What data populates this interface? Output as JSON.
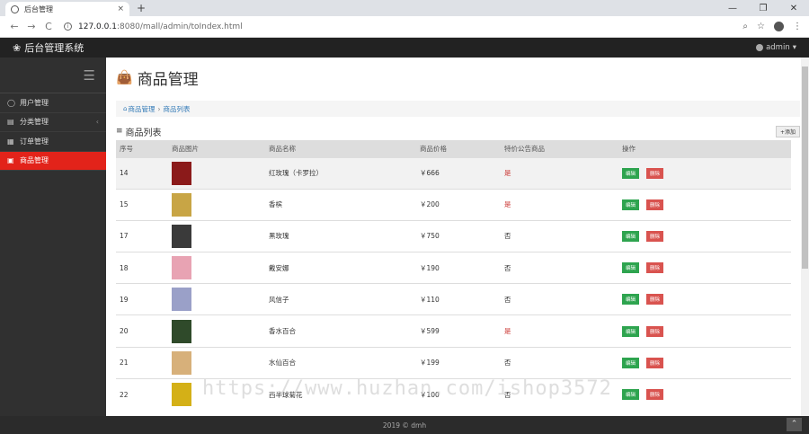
{
  "browser": {
    "tab_title": "后台管理",
    "tab_close": "×",
    "new_tab": "+",
    "win_min": "—",
    "win_max": "❐",
    "win_close": "✕",
    "url_host": "127.0.0.1",
    "url_path": ":8080/mall/admin/toIndex.html",
    "back": "←",
    "forward": "→",
    "reload": "C",
    "zoom_icon": "⌕",
    "star_icon": "☆",
    "menu_icon": "⋮"
  },
  "header": {
    "brand": "后台管理系统",
    "user": "admin"
  },
  "sidebar": {
    "items": [
      {
        "label": "用户管理",
        "icon": "user-icon",
        "glyph": "◯"
      },
      {
        "label": "分类管理",
        "icon": "category-icon",
        "glyph": "▤"
      },
      {
        "label": "订单管理",
        "icon": "order-icon",
        "glyph": "▦"
      },
      {
        "label": "商品管理",
        "icon": "bag-icon",
        "glyph": "▣"
      }
    ],
    "chevron": "‹",
    "active_index": 3
  },
  "main": {
    "title": "商品管理",
    "breadcrumb": [
      "商品管理",
      "商品列表"
    ],
    "section_title": "商品列表",
    "add_button": "+添加",
    "columns": [
      "序号",
      "商品图片",
      "商品名称",
      "商品价格",
      "特价公告商品",
      "操作"
    ],
    "rows": [
      {
        "id": "14",
        "name": "红玫瑰（卡罗拉）",
        "price": "￥666",
        "special": "是",
        "thumb": "#8b1a1a"
      },
      {
        "id": "15",
        "name": "香槟",
        "price": "￥200",
        "special": "是",
        "thumb": "#c8a545"
      },
      {
        "id": "17",
        "name": "黑玫瑰",
        "price": "￥750",
        "special": "否",
        "thumb": "#3a3a3a"
      },
      {
        "id": "18",
        "name": "戴安娜",
        "price": "￥190",
        "special": "否",
        "thumb": "#e8a3b3"
      },
      {
        "id": "19",
        "name": "风信子",
        "price": "￥110",
        "special": "否",
        "thumb": "#9aa0c8"
      },
      {
        "id": "20",
        "name": "香水百合",
        "price": "￥599",
        "special": "是",
        "thumb": "#2f4a2a"
      },
      {
        "id": "21",
        "name": "水仙百合",
        "price": "￥199",
        "special": "否",
        "thumb": "#d7b07a"
      },
      {
        "id": "22",
        "name": "西半球菊花",
        "price": "￥100",
        "special": "否",
        "thumb": "#d4b017"
      }
    ],
    "edit_label": "编辑",
    "delete_label": "删除"
  },
  "footer": {
    "text": "2019 © dmh"
  },
  "watermark": "https://www.huzhan.com/ishop3572",
  "colors": {
    "accent": "#e2231a",
    "edit": "#2ea44f",
    "delete": "#d9534f",
    "link": "#337ab7"
  }
}
